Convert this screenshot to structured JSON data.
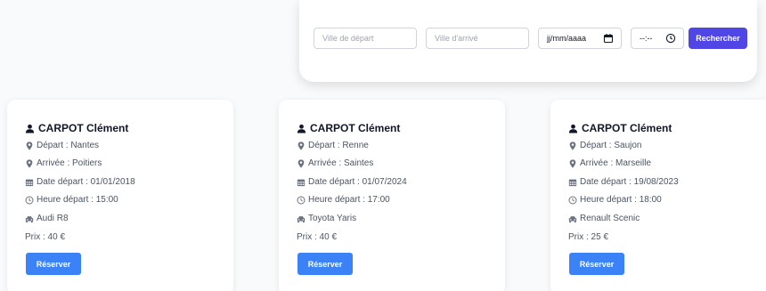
{
  "search": {
    "from_placeholder": "Ville de départ",
    "to_placeholder": "Ville d'arrivé",
    "date_placeholder": "jj/mm/aaaa",
    "time_placeholder": "--:--",
    "button_label": "Rechercher"
  },
  "colors": {
    "primary": "#4f46e5",
    "book_button": "#3b82f6"
  },
  "icons": [
    "calendar-icon",
    "clock-icon",
    "user-icon",
    "map-marker-icon",
    "calendar-grid-icon",
    "car-icon"
  ],
  "rides": [
    {
      "driver": "CARPOT Clément",
      "departure": "Départ : Nantes",
      "arrival": "Arrivée : Poitiers",
      "date": "Date départ : 01/01/2018",
      "time": "Heure départ : 15:00",
      "car": "Audi R8",
      "price": "Prix : 40 €",
      "button_label": "Réserver"
    },
    {
      "driver": "CARPOT Clément",
      "departure": "Départ : Renne",
      "arrival": "Arrivée : Saintes",
      "date": "Date départ : 01/07/2024",
      "time": "Heure départ : 17:00",
      "car": "Toyota Yaris",
      "price": "Prix : 40 €",
      "button_label": "Réserver"
    },
    {
      "driver": "CARPOT Clément",
      "departure": "Départ : Saujon",
      "arrival": "Arrivée : Marseille",
      "date": "Date départ : 19/08/2023",
      "time": "Heure départ : 18:00",
      "car": "Renault Scenic",
      "price": "Prix : 25 €",
      "button_label": "Réserver"
    }
  ]
}
